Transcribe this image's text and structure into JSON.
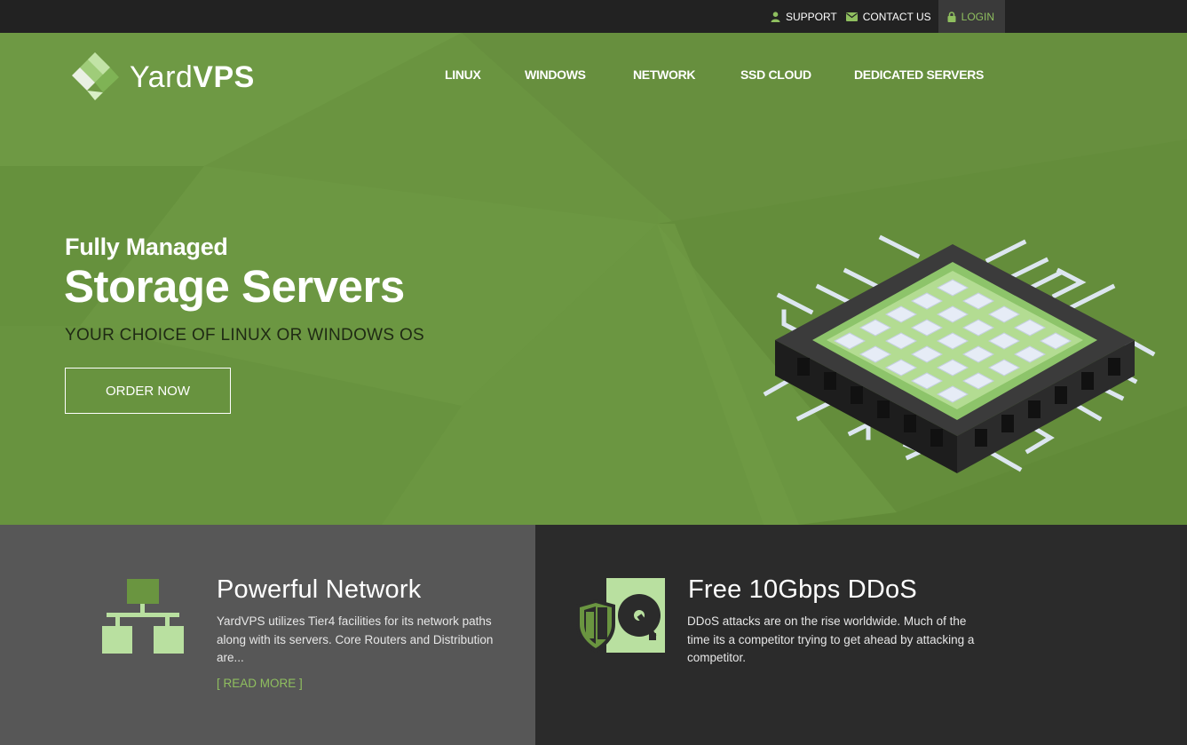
{
  "topbar": {
    "support": "SUPPORT",
    "contact": "CONTACT US",
    "login": "LOGIN"
  },
  "brand": {
    "name_light": "Yard",
    "name_bold": "VPS"
  },
  "nav": [
    "LINUX",
    "WINDOWS",
    "NETWORK",
    "SSD CLOUD",
    "DEDICATED SERVERS"
  ],
  "hero": {
    "kicker": "Fully Managed",
    "title": "Storage Servers",
    "subtitle": "YOUR CHOICE OF LINUX OR WINDOWS OS",
    "cta": "ORDER NOW"
  },
  "features": [
    {
      "title": "Powerful Network",
      "text": "YardVPS utilizes Tier4 facilities for its network paths along with its servers. Core Routers and Distribution are...",
      "link": "[ READ MORE ]",
      "icon": "network-icon"
    },
    {
      "title": "Free 10Gbps DDoS",
      "text": "DDoS attacks are on the rise worldwide. Much of the time its a competitor trying to get ahead by attacking a competitor.",
      "icon": "ddos-shield-disk-icon"
    }
  ],
  "colors": {
    "hero_green": "#6a9540",
    "accent_green": "#8fbf5f",
    "topbar": "#222222",
    "panel_gray": "#575757",
    "panel_dark": "#2b2b2b"
  }
}
